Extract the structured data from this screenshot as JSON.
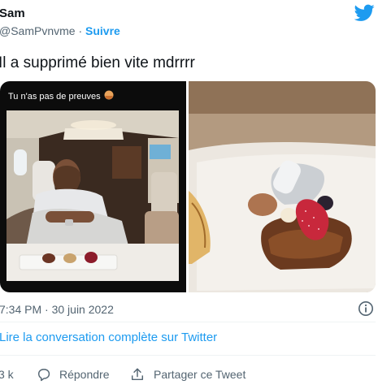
{
  "tweet": {
    "author_name": "Sam",
    "handle": "@SamPvnvme",
    "separator": " · ",
    "follow_label": "Suivre",
    "text": "Il a supprimé bien vite mdrrrr",
    "timestamp": "7:34 PM · 30 juin 2022",
    "read_conversation": "Lire la conversation complète sur Twitter"
  },
  "media": {
    "left_caption": "Tu n'as pas de preuves",
    "left_caption_emoji": "pie-emoji-icon",
    "images": [
      "man-sleeping-in-private-jet",
      "dessert-closeup"
    ]
  },
  "actions": {
    "likes_count": "3 k",
    "reply_label": "Répondre",
    "share_label": "Partager ce Tweet"
  },
  "colors": {
    "accent": "#1d9bf0",
    "secondary_text": "#536471",
    "text": "#0f1419",
    "like_red": "#f91880",
    "separator": "#eff3f4"
  }
}
